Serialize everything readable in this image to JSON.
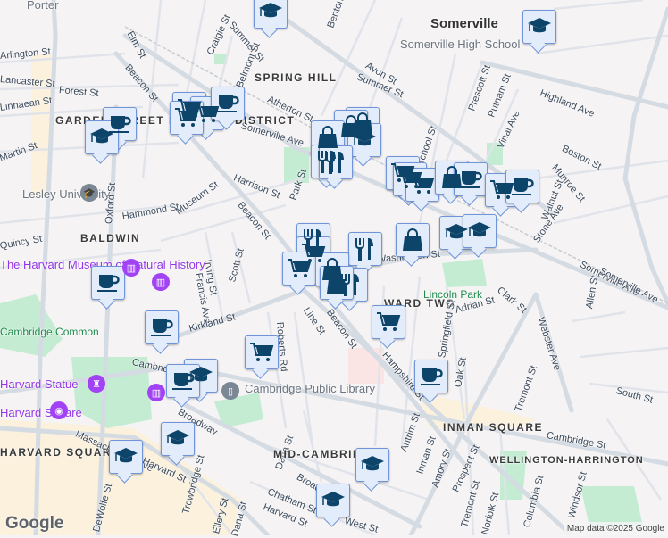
{
  "map": {
    "attribution": "Map data ©2025 Google",
    "logo": "Google",
    "colors": {
      "background": "#f5f3f4",
      "road": "#d5dbe2",
      "park": "#c3ecd2",
      "marker_fill": "#e3ecfb",
      "marker_border": "#6f95d8",
      "icon": "#0d4469",
      "commercial": "#fbf1dc"
    },
    "labels": [
      "Porter",
      "Elm St",
      "Craigie St",
      "Summer St",
      "Belmont St",
      "Benton Rd",
      "Somerville",
      "Somerville High School",
      "Avon St",
      "Summer St",
      "Prescott St",
      "Putnam St",
      "Vinal Ave",
      "Highland Ave",
      "Walnut St",
      "Boston St",
      "Munroe St",
      "Stone Ave",
      "SPRING HILL",
      "Atherton St",
      "Somerville Ave",
      "Somerville Ave",
      "Beacon St",
      "Beacon St",
      "Arlington St",
      "Lancaster St",
      "Forest St",
      "Linnaean St",
      "GARDEN STREET HISTORIC DISTRICT",
      "Martin St",
      "Lesley University",
      "Oxford St",
      "Hammond St",
      "Museum St",
      "Harrison St",
      "Park St",
      "BALDWIN",
      "Quincy St",
      "The Harvard Museum of Natural History",
      "Irving St",
      "Francis Ave",
      "Scott St",
      "Kirkland St",
      "Washington St",
      "School St",
      "Lincoln Park",
      "WARD TWO",
      "Adrian St",
      "Clark St",
      "Webster Ave",
      "Allen St",
      "Somerville Ave",
      "Cambridge Common",
      "Cambridge St",
      "Harvard Statue",
      "Harvard Square",
      "HARVARD SQUARE",
      "Cambridge Public Library",
      "Broadway",
      "Massachusetts Ave",
      "Harvard St",
      "Trowbridge St",
      "Dana St",
      "MID-CAMBRIDGE",
      "Line St",
      "Roberts Rd",
      "Beacon St",
      "Springfield St",
      "Oak St",
      "Tremont St",
      "South St",
      "INMAN SQUARE",
      "Cambridge St",
      "WELLINGTON-HARRINGTON",
      "Antrim St",
      "Inman St",
      "Amory St",
      "Prospect St",
      "Tremont St",
      "Norfolk St",
      "Columbia St",
      "Windsor St",
      "Chatham St",
      "Harvard St",
      "Broadway",
      "West St",
      "DeWolfe St",
      "Ellery St",
      "Dana St",
      "Hampshire St"
    ],
    "markers": [
      "education",
      "education",
      "coffee",
      "education",
      "cart",
      "cart",
      "coffee",
      "cart",
      "bag",
      "bag",
      "education",
      "bag",
      "restaurant",
      "restaurant",
      "cart",
      "cart",
      "cart",
      "bag",
      "coffee",
      "cart",
      "coffee",
      "education",
      "education",
      "bag",
      "restaurant",
      "restaurant",
      "cart",
      "cart",
      "bag",
      "restaurant",
      "bag",
      "coffee",
      "coffee",
      "cart",
      "education",
      "coffee",
      "cart",
      "coffee",
      "education",
      "education",
      "education",
      "education"
    ]
  }
}
